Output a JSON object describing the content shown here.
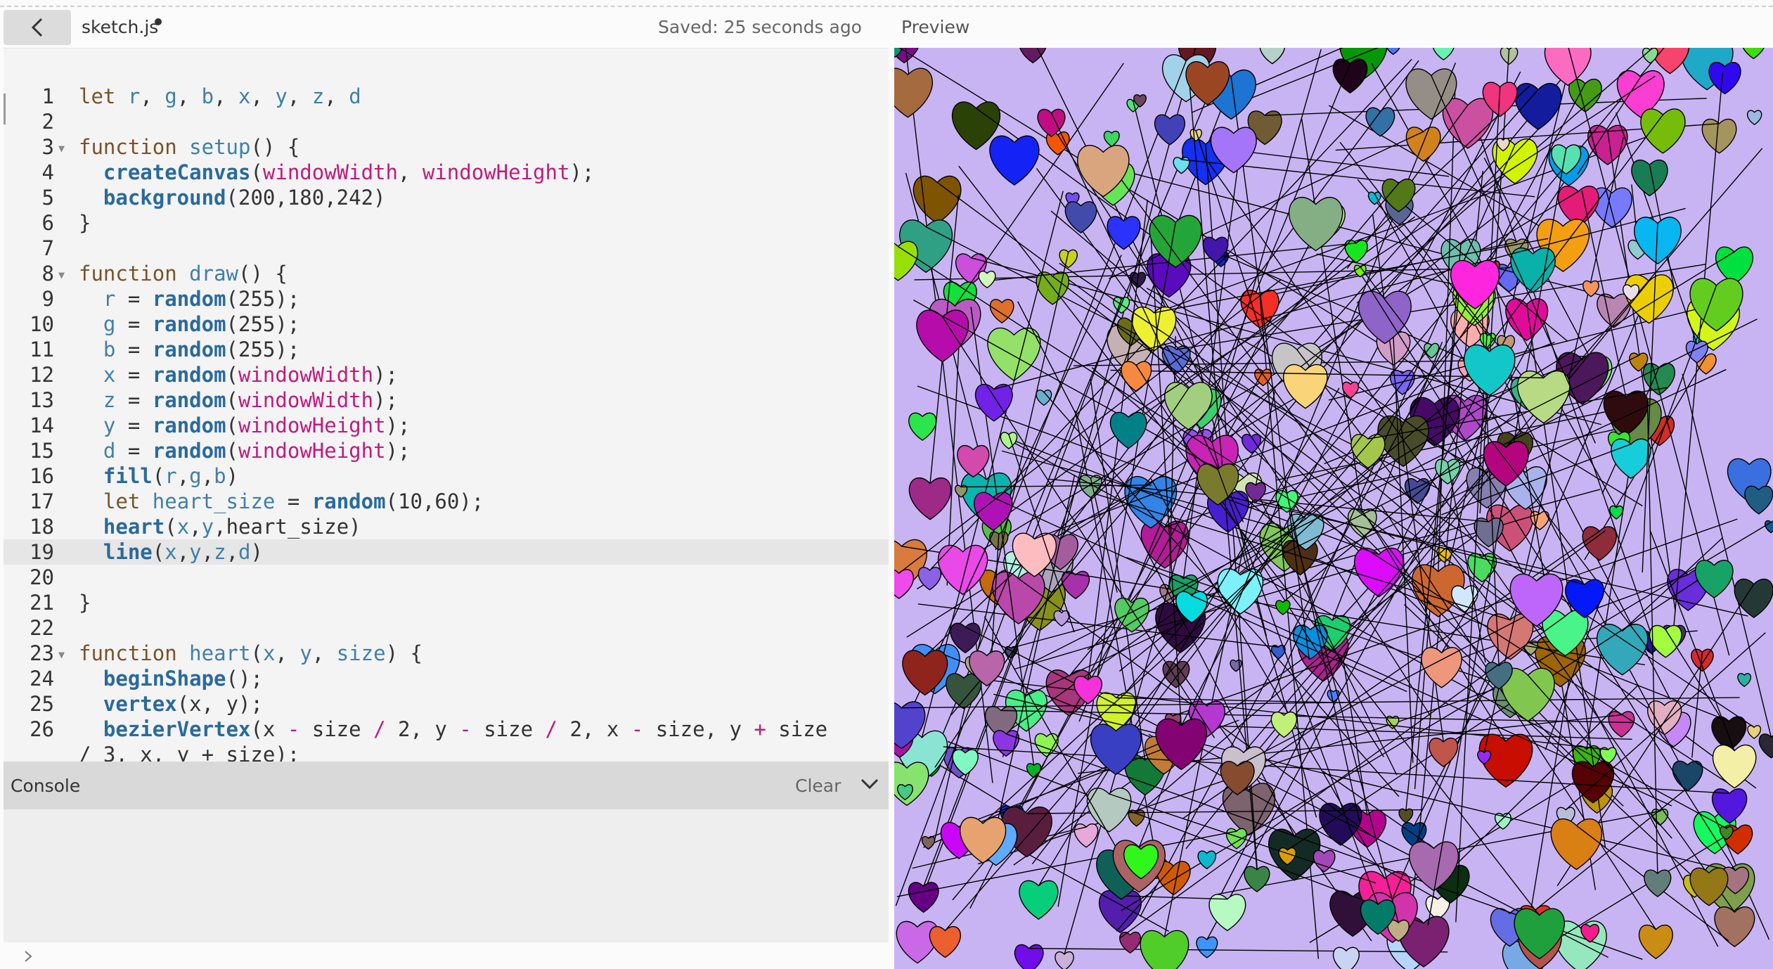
{
  "topbar": {
    "file_name": "sketch.js",
    "saved_status": "Saved: 25 seconds ago",
    "preview_label": "Preview"
  },
  "editor": {
    "lines": [
      {
        "n": "1",
        "code": "<span class='kw'>let</span> <span class='var'>r</span>, <span class='var'>g</span>, <span class='var'>b</span>, <span class='var'>x</span>, <span class='var'>y</span>, <span class='var'>z</span>, <span class='var'>d</span>"
      },
      {
        "n": "2",
        "code": ""
      },
      {
        "n": "3",
        "fold": true,
        "code": "<span class='kw'>function</span> <span class='var'>setup</span>() {"
      },
      {
        "n": "4",
        "code": "  <span class='fn'>createCanvas</span>(<span class='str'>windowWidth</span>, <span class='str'>windowHeight</span>);"
      },
      {
        "n": "5",
        "code": "  <span class='fn'>background</span>(200,180,242)"
      },
      {
        "n": "6",
        "code": "}"
      },
      {
        "n": "7",
        "code": ""
      },
      {
        "n": "8",
        "fold": true,
        "code": "<span class='kw'>function</span> <span class='var'>draw</span>() {"
      },
      {
        "n": "9",
        "code": "  <span class='var'>r</span> = <span class='fn'>random</span>(255);"
      },
      {
        "n": "10",
        "code": "  <span class='var'>g</span> = <span class='fn'>random</span>(255);"
      },
      {
        "n": "11",
        "code": "  <span class='var'>b</span> = <span class='fn'>random</span>(255);"
      },
      {
        "n": "12",
        "code": "  <span class='var'>x</span> = <span class='fn'>random</span>(<span class='str'>windowWidth</span>);"
      },
      {
        "n": "13",
        "code": "  <span class='var'>z</span> = <span class='fn'>random</span>(<span class='str'>windowWidth</span>);"
      },
      {
        "n": "14",
        "code": "  <span class='var'>y</span> = <span class='fn'>random</span>(<span class='str'>windowHeight</span>);"
      },
      {
        "n": "15",
        "code": "  <span class='var'>d</span> = <span class='fn'>random</span>(<span class='str'>windowHeight</span>);"
      },
      {
        "n": "16",
        "code": "  <span class='fn'>fill</span>(<span class='var'>r</span>,<span class='var'>g</span>,<span class='var'>b</span>)"
      },
      {
        "n": "17",
        "code": "  <span class='kw'>let</span> <span class='var'>heart_size</span> = <span class='fn'>random</span>(10,60);"
      },
      {
        "n": "18",
        "code": "  <span class='fn'>heart</span>(<span class='var'>x</span>,<span class='var'>y</span>,heart_size)"
      },
      {
        "n": "19",
        "active": true,
        "code": "  <span class='fn'>line</span>(<span class='var'>x</span>,<span class='var'>y</span>,<span class='var'>z</span>,<span class='var'>d</span>)"
      },
      {
        "n": "20",
        "code": ""
      },
      {
        "n": "21",
        "code": "}"
      },
      {
        "n": "22",
        "code": ""
      },
      {
        "n": "23",
        "fold": true,
        "code": "<span class='kw'>function</span> <span class='var'>heart</span>(<span class='var'>x</span>, <span class='var'>y</span>, <span class='var'>size</span>) {"
      },
      {
        "n": "24",
        "code": "  <span class='fn'>beginShape</span>();"
      },
      {
        "n": "25",
        "code": "  <span class='fn'>vertex</span>(x, y);"
      },
      {
        "n": "26",
        "code": "  <span class='fn'>bezierVertex</span>(x <span class='str'>-</span> size <span class='str'>/</span> 2, y <span class='str'>-</span> size <span class='str'>/</span> 2, x <span class='str'>-</span> size, y <span class='str'>+</span> size"
      },
      {
        "n": "",
        "code": "/ 3, x, y + size);"
      }
    ]
  },
  "console": {
    "title": "Console",
    "clear_label": "Clear"
  },
  "preview": {
    "background": "#c8b4f2",
    "heart_count": 360,
    "line_count": 260
  },
  "icons": {
    "back": "chevron-left-icon",
    "collapse": "chevron-down-icon",
    "prompt": "chevron-right-icon"
  }
}
